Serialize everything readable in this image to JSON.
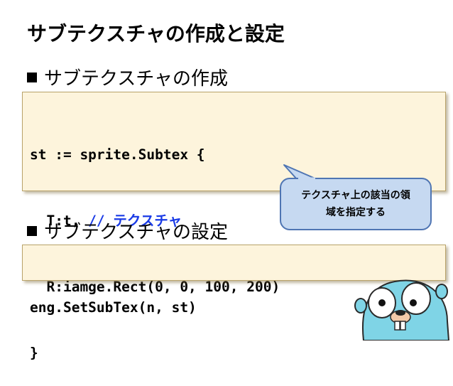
{
  "slide": {
    "title": "サブテクスチャの作成と設定",
    "section1": {
      "label": "サブテクスチャの作成"
    },
    "code1": {
      "line1": "st := sprite.Subtex {",
      "line2_code": "  T:t, ",
      "line2_comment": "// テクスチャ",
      "line3": "  R:iamge.Rect(0, 0, 100, 200)",
      "line4": "}"
    },
    "callout": {
      "line1": "テクスチャ上の該当の領",
      "line2": "域を指定する"
    },
    "section2": {
      "label": "サブテクスチャの設定"
    },
    "code2": {
      "line1": "eng.SetSubTex(n, st)"
    }
  },
  "colors": {
    "code_background": "#fdf4dc",
    "comment": "#1a3be6",
    "callout_fill": "#c6d9f1",
    "callout_border": "#4f75b3",
    "gopher": "#7fd4e6"
  },
  "icons": {
    "mascot": "go-gopher-icon"
  }
}
